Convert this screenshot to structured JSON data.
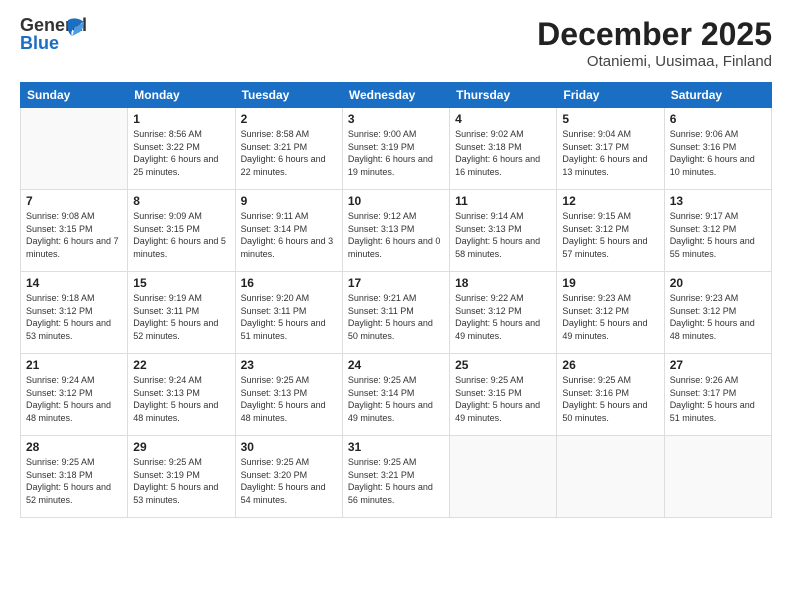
{
  "header": {
    "logo_general": "General",
    "logo_blue": "Blue",
    "month_title": "December 2025",
    "location": "Otaniemi, Uusimaa, Finland"
  },
  "weekdays": [
    "Sunday",
    "Monday",
    "Tuesday",
    "Wednesday",
    "Thursday",
    "Friday",
    "Saturday"
  ],
  "weeks": [
    [
      {
        "day": "",
        "sunrise": "",
        "sunset": "",
        "daylight": ""
      },
      {
        "day": "1",
        "sunrise": "Sunrise: 8:56 AM",
        "sunset": "Sunset: 3:22 PM",
        "daylight": "Daylight: 6 hours and 25 minutes."
      },
      {
        "day": "2",
        "sunrise": "Sunrise: 8:58 AM",
        "sunset": "Sunset: 3:21 PM",
        "daylight": "Daylight: 6 hours and 22 minutes."
      },
      {
        "day": "3",
        "sunrise": "Sunrise: 9:00 AM",
        "sunset": "Sunset: 3:19 PM",
        "daylight": "Daylight: 6 hours and 19 minutes."
      },
      {
        "day": "4",
        "sunrise": "Sunrise: 9:02 AM",
        "sunset": "Sunset: 3:18 PM",
        "daylight": "Daylight: 6 hours and 16 minutes."
      },
      {
        "day": "5",
        "sunrise": "Sunrise: 9:04 AM",
        "sunset": "Sunset: 3:17 PM",
        "daylight": "Daylight: 6 hours and 13 minutes."
      },
      {
        "day": "6",
        "sunrise": "Sunrise: 9:06 AM",
        "sunset": "Sunset: 3:16 PM",
        "daylight": "Daylight: 6 hours and 10 minutes."
      }
    ],
    [
      {
        "day": "7",
        "sunrise": "Sunrise: 9:08 AM",
        "sunset": "Sunset: 3:15 PM",
        "daylight": "Daylight: 6 hours and 7 minutes."
      },
      {
        "day": "8",
        "sunrise": "Sunrise: 9:09 AM",
        "sunset": "Sunset: 3:15 PM",
        "daylight": "Daylight: 6 hours and 5 minutes."
      },
      {
        "day": "9",
        "sunrise": "Sunrise: 9:11 AM",
        "sunset": "Sunset: 3:14 PM",
        "daylight": "Daylight: 6 hours and 3 minutes."
      },
      {
        "day": "10",
        "sunrise": "Sunrise: 9:12 AM",
        "sunset": "Sunset: 3:13 PM",
        "daylight": "Daylight: 6 hours and 0 minutes."
      },
      {
        "day": "11",
        "sunrise": "Sunrise: 9:14 AM",
        "sunset": "Sunset: 3:13 PM",
        "daylight": "Daylight: 5 hours and 58 minutes."
      },
      {
        "day": "12",
        "sunrise": "Sunrise: 9:15 AM",
        "sunset": "Sunset: 3:12 PM",
        "daylight": "Daylight: 5 hours and 57 minutes."
      },
      {
        "day": "13",
        "sunrise": "Sunrise: 9:17 AM",
        "sunset": "Sunset: 3:12 PM",
        "daylight": "Daylight: 5 hours and 55 minutes."
      }
    ],
    [
      {
        "day": "14",
        "sunrise": "Sunrise: 9:18 AM",
        "sunset": "Sunset: 3:12 PM",
        "daylight": "Daylight: 5 hours and 53 minutes."
      },
      {
        "day": "15",
        "sunrise": "Sunrise: 9:19 AM",
        "sunset": "Sunset: 3:11 PM",
        "daylight": "Daylight: 5 hours and 52 minutes."
      },
      {
        "day": "16",
        "sunrise": "Sunrise: 9:20 AM",
        "sunset": "Sunset: 3:11 PM",
        "daylight": "Daylight: 5 hours and 51 minutes."
      },
      {
        "day": "17",
        "sunrise": "Sunrise: 9:21 AM",
        "sunset": "Sunset: 3:11 PM",
        "daylight": "Daylight: 5 hours and 50 minutes."
      },
      {
        "day": "18",
        "sunrise": "Sunrise: 9:22 AM",
        "sunset": "Sunset: 3:12 PM",
        "daylight": "Daylight: 5 hours and 49 minutes."
      },
      {
        "day": "19",
        "sunrise": "Sunrise: 9:23 AM",
        "sunset": "Sunset: 3:12 PM",
        "daylight": "Daylight: 5 hours and 49 minutes."
      },
      {
        "day": "20",
        "sunrise": "Sunrise: 9:23 AM",
        "sunset": "Sunset: 3:12 PM",
        "daylight": "Daylight: 5 hours and 48 minutes."
      }
    ],
    [
      {
        "day": "21",
        "sunrise": "Sunrise: 9:24 AM",
        "sunset": "Sunset: 3:12 PM",
        "daylight": "Daylight: 5 hours and 48 minutes."
      },
      {
        "day": "22",
        "sunrise": "Sunrise: 9:24 AM",
        "sunset": "Sunset: 3:13 PM",
        "daylight": "Daylight: 5 hours and 48 minutes."
      },
      {
        "day": "23",
        "sunrise": "Sunrise: 9:25 AM",
        "sunset": "Sunset: 3:13 PM",
        "daylight": "Daylight: 5 hours and 48 minutes."
      },
      {
        "day": "24",
        "sunrise": "Sunrise: 9:25 AM",
        "sunset": "Sunset: 3:14 PM",
        "daylight": "Daylight: 5 hours and 49 minutes."
      },
      {
        "day": "25",
        "sunrise": "Sunrise: 9:25 AM",
        "sunset": "Sunset: 3:15 PM",
        "daylight": "Daylight: 5 hours and 49 minutes."
      },
      {
        "day": "26",
        "sunrise": "Sunrise: 9:25 AM",
        "sunset": "Sunset: 3:16 PM",
        "daylight": "Daylight: 5 hours and 50 minutes."
      },
      {
        "day": "27",
        "sunrise": "Sunrise: 9:26 AM",
        "sunset": "Sunset: 3:17 PM",
        "daylight": "Daylight: 5 hours and 51 minutes."
      }
    ],
    [
      {
        "day": "28",
        "sunrise": "Sunrise: 9:25 AM",
        "sunset": "Sunset: 3:18 PM",
        "daylight": "Daylight: 5 hours and 52 minutes."
      },
      {
        "day": "29",
        "sunrise": "Sunrise: 9:25 AM",
        "sunset": "Sunset: 3:19 PM",
        "daylight": "Daylight: 5 hours and 53 minutes."
      },
      {
        "day": "30",
        "sunrise": "Sunrise: 9:25 AM",
        "sunset": "Sunset: 3:20 PM",
        "daylight": "Daylight: 5 hours and 54 minutes."
      },
      {
        "day": "31",
        "sunrise": "Sunrise: 9:25 AM",
        "sunset": "Sunset: 3:21 PM",
        "daylight": "Daylight: 5 hours and 56 minutes."
      },
      {
        "day": "",
        "sunrise": "",
        "sunset": "",
        "daylight": ""
      },
      {
        "day": "",
        "sunrise": "",
        "sunset": "",
        "daylight": ""
      },
      {
        "day": "",
        "sunrise": "",
        "sunset": "",
        "daylight": ""
      }
    ]
  ]
}
